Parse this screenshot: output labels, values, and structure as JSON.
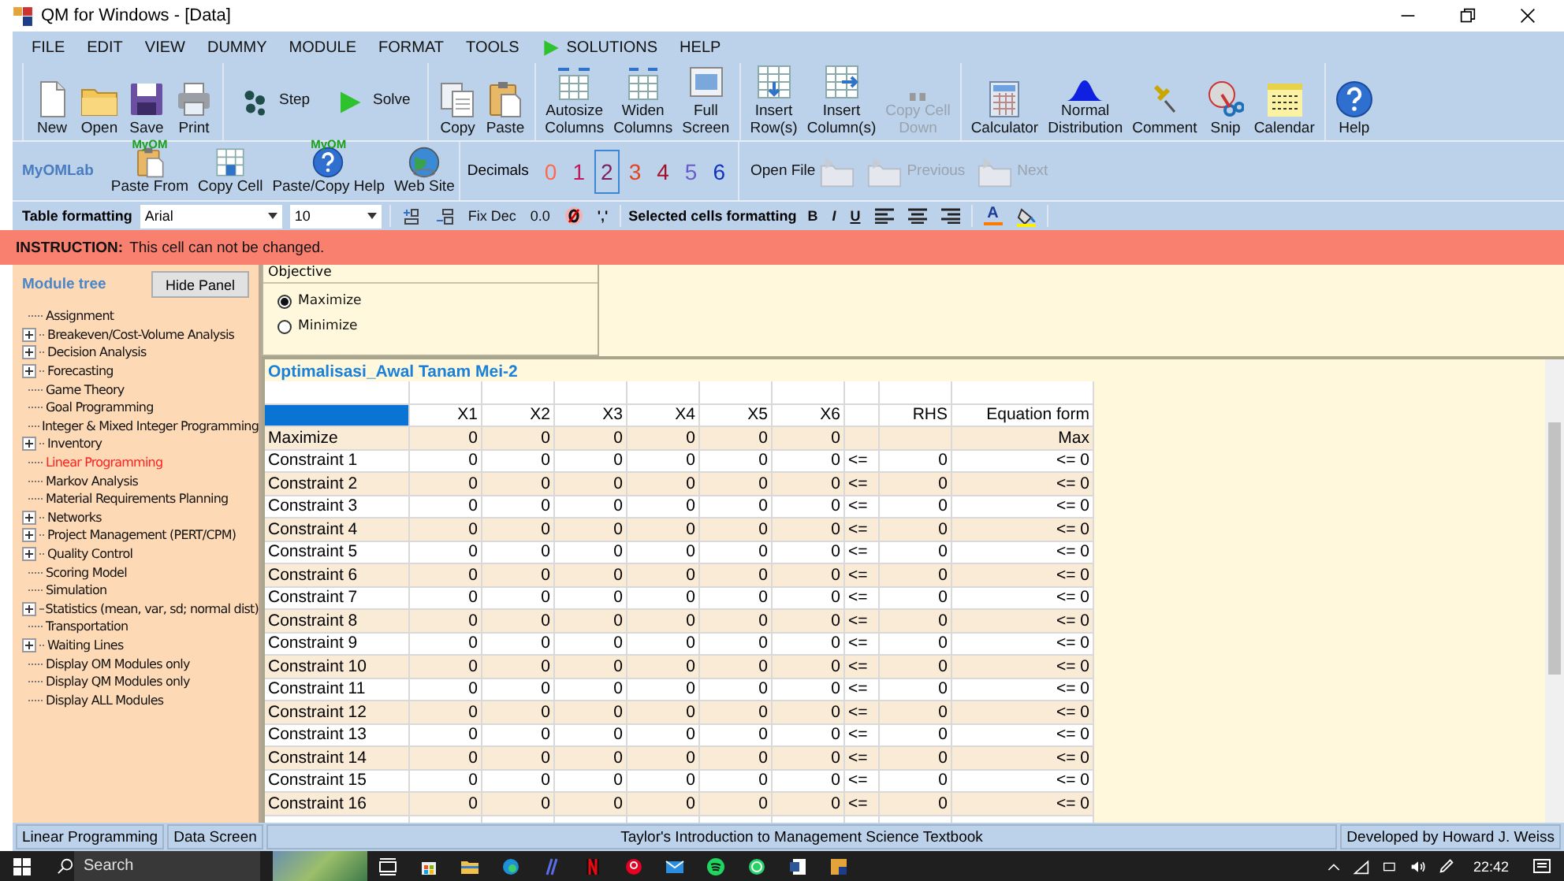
{
  "window": {
    "title": "QM for Windows - [Data]"
  },
  "menu": [
    {
      "label": "FILE",
      "kind": "text"
    },
    {
      "label": "EDIT",
      "kind": "text"
    },
    {
      "label": "VIEW",
      "kind": "text"
    },
    {
      "label": "DUMMY",
      "kind": "text"
    },
    {
      "label": "MODULE",
      "kind": "text"
    },
    {
      "label": "FORMAT",
      "kind": "text"
    },
    {
      "label": "TOOLS",
      "kind": "text"
    },
    {
      "label": "SOLUTIONS",
      "kind": "play"
    },
    {
      "label": "HELP",
      "kind": "text"
    }
  ],
  "toolbar": {
    "groups": [
      [
        {
          "label": "New",
          "kind": "stacked",
          "disabled": false
        },
        {
          "label": "Open",
          "kind": "stacked",
          "disabled": false
        },
        {
          "label": "Save",
          "kind": "stacked",
          "disabled": false
        },
        {
          "label": "Print",
          "kind": "stacked",
          "disabled": false
        }
      ],
      [
        {
          "label": "Step",
          "kind": "inline",
          "disabled": false
        },
        {
          "label": "Solve",
          "kind": "inline",
          "disabled": false
        }
      ],
      [
        {
          "label": "Copy",
          "kind": "stacked",
          "disabled": false
        },
        {
          "label": "Paste",
          "kind": "stacked",
          "disabled": false
        }
      ],
      [
        {
          "label": "Autosize\nColumns",
          "kind": "stacked",
          "disabled": false
        },
        {
          "label": "Widen\nColumns",
          "kind": "stacked",
          "disabled": false
        },
        {
          "label": "Full\nScreen",
          "kind": "stacked",
          "disabled": false
        }
      ],
      [
        {
          "label": "Insert\nRow(s)",
          "kind": "stacked",
          "disabled": false
        },
        {
          "label": "Insert\nColumn(s)",
          "kind": "stacked",
          "disabled": false
        },
        {
          "label": "Copy Cell\nDown",
          "kind": "stacked",
          "disabled": true
        }
      ],
      [
        {
          "label": "Calculator",
          "kind": "stacked",
          "disabled": false
        },
        {
          "label": "Normal\nDistribution",
          "kind": "stacked",
          "disabled": false
        },
        {
          "label": "Comment",
          "kind": "stacked",
          "disabled": false
        },
        {
          "label": "Snip",
          "kind": "stacked",
          "disabled": false
        },
        {
          "label": "Calendar",
          "kind": "stacked",
          "disabled": false
        }
      ],
      [
        {
          "label": "Help",
          "kind": "stacked",
          "disabled": false
        }
      ]
    ]
  },
  "toolbar2": {
    "brand": "MyOMLab",
    "buttons": [
      {
        "label": "Paste From",
        "badge": "MyOM"
      },
      {
        "label": "Copy Cell"
      },
      {
        "label": "Paste/Copy Help",
        "badge": "MyOM"
      },
      {
        "label": "Web Site"
      }
    ],
    "decimals": {
      "label": "Decimals",
      "digits": [
        {
          "label": "0",
          "color": "#ff6a4d",
          "selected": false
        },
        {
          "label": "1",
          "color": "#c2185b",
          "selected": false
        },
        {
          "label": "2",
          "color": "#7b1f5a",
          "selected": true
        },
        {
          "label": "3",
          "color": "#e8401c",
          "selected": false
        },
        {
          "label": "4",
          "color": "#a3102a",
          "selected": false
        },
        {
          "label": "5",
          "color": "#6a5acd",
          "selected": false
        },
        {
          "label": "6",
          "color": "#1030c0",
          "selected": false
        }
      ]
    },
    "files": [
      {
        "label": "Open File",
        "disabled": false
      },
      {
        "label": "Previous",
        "disabled": true
      },
      {
        "label": "Next",
        "disabled": true
      }
    ]
  },
  "format_bar": {
    "label": "Table formatting",
    "font": "Arial",
    "size": "10",
    "fix_dec": "Fix Dec",
    "zero_format": "0.0",
    "comma": "','",
    "selected_label": "Selected cells formatting",
    "styles": [
      "B",
      "I",
      "U"
    ],
    "font_color": "A"
  },
  "instruction": {
    "label": "INSTRUCTION:",
    "text": "This cell can not be changed."
  },
  "module_tree": {
    "title": "Module tree",
    "hide_button": "Hide Panel",
    "items": [
      {
        "label": "Assignment",
        "kind": "leaf",
        "selected": false
      },
      {
        "label": "Breakeven/Cost-Volume Analysis",
        "kind": "branch",
        "selected": false
      },
      {
        "label": "Decision Analysis",
        "kind": "branch",
        "selected": false
      },
      {
        "label": "Forecasting",
        "kind": "branch",
        "selected": false
      },
      {
        "label": "Game Theory",
        "kind": "leaf",
        "selected": false
      },
      {
        "label": "Goal Programming",
        "kind": "leaf",
        "selected": false
      },
      {
        "label": "Integer & Mixed Integer Programming",
        "kind": "leaf",
        "selected": false
      },
      {
        "label": "Inventory",
        "kind": "branch",
        "selected": false
      },
      {
        "label": "Linear Programming",
        "kind": "leaf",
        "selected": true
      },
      {
        "label": "Markov Analysis",
        "kind": "leaf",
        "selected": false
      },
      {
        "label": "Material Requirements Planning",
        "kind": "leaf",
        "selected": false
      },
      {
        "label": "Networks",
        "kind": "branch",
        "selected": false
      },
      {
        "label": "Project Management (PERT/CPM)",
        "kind": "branch",
        "selected": false
      },
      {
        "label": "Quality Control",
        "kind": "branch",
        "selected": false
      },
      {
        "label": "Scoring Model",
        "kind": "leaf",
        "selected": false
      },
      {
        "label": "Simulation",
        "kind": "leaf",
        "selected": false
      },
      {
        "label": "Statistics (mean, var, sd; normal dist)",
        "kind": "branch",
        "selected": false
      },
      {
        "label": "Transportation",
        "kind": "leaf",
        "selected": false
      },
      {
        "label": "Waiting Lines",
        "kind": "branch",
        "selected": false
      },
      {
        "label": "Display OM Modules only",
        "kind": "leaf",
        "selected": false
      },
      {
        "label": "Display QM Modules only",
        "kind": "leaf",
        "selected": false
      },
      {
        "label": "Display ALL Modules",
        "kind": "leaf",
        "selected": false
      }
    ]
  },
  "objective": {
    "legend": "Objective",
    "options": [
      {
        "label": "Maximize",
        "selected": true
      },
      {
        "label": "Minimize",
        "selected": false
      }
    ]
  },
  "table": {
    "title": "Optimalisasi_Awal Tanam Mei-2",
    "corner_selected": true,
    "columns": [
      "X1",
      "X2",
      "X3",
      "X4",
      "X5",
      "X6"
    ],
    "rhs_header": "RHS",
    "equation_header": "Equation form",
    "rows": [
      {
        "name": "Maximize",
        "values": [
          "0",
          "0",
          "0",
          "0",
          "0",
          "0"
        ],
        "equation": "Max"
      },
      {
        "name": "Constraint 1",
        "values": [
          "0",
          "0",
          "0",
          "0",
          "0",
          "0"
        ],
        "sign": "<=",
        "rhs": "0",
        "equation": "<= 0"
      },
      {
        "name": "Constraint 2",
        "values": [
          "0",
          "0",
          "0",
          "0",
          "0",
          "0"
        ],
        "sign": "<=",
        "rhs": "0",
        "equation": "<= 0"
      },
      {
        "name": "Constraint 3",
        "values": [
          "0",
          "0",
          "0",
          "0",
          "0",
          "0"
        ],
        "sign": "<=",
        "rhs": "0",
        "equation": "<= 0"
      },
      {
        "name": "Constraint 4",
        "values": [
          "0",
          "0",
          "0",
          "0",
          "0",
          "0"
        ],
        "sign": "<=",
        "rhs": "0",
        "equation": "<= 0"
      },
      {
        "name": "Constraint 5",
        "values": [
          "0",
          "0",
          "0",
          "0",
          "0",
          "0"
        ],
        "sign": "<=",
        "rhs": "0",
        "equation": "<= 0"
      },
      {
        "name": "Constraint 6",
        "values": [
          "0",
          "0",
          "0",
          "0",
          "0",
          "0"
        ],
        "sign": "<=",
        "rhs": "0",
        "equation": "<= 0"
      },
      {
        "name": "Constraint 7",
        "values": [
          "0",
          "0",
          "0",
          "0",
          "0",
          "0"
        ],
        "sign": "<=",
        "rhs": "0",
        "equation": "<= 0"
      },
      {
        "name": "Constraint 8",
        "values": [
          "0",
          "0",
          "0",
          "0",
          "0",
          "0"
        ],
        "sign": "<=",
        "rhs": "0",
        "equation": "<= 0"
      },
      {
        "name": "Constraint 9",
        "values": [
          "0",
          "0",
          "0",
          "0",
          "0",
          "0"
        ],
        "sign": "<=",
        "rhs": "0",
        "equation": "<= 0"
      },
      {
        "name": "Constraint 10",
        "values": [
          "0",
          "0",
          "0",
          "0",
          "0",
          "0"
        ],
        "sign": "<=",
        "rhs": "0",
        "equation": "<= 0"
      },
      {
        "name": "Constraint 11",
        "values": [
          "0",
          "0",
          "0",
          "0",
          "0",
          "0"
        ],
        "sign": "<=",
        "rhs": "0",
        "equation": "<= 0"
      },
      {
        "name": "Constraint 12",
        "values": [
          "0",
          "0",
          "0",
          "0",
          "0",
          "0"
        ],
        "sign": "<=",
        "rhs": "0",
        "equation": "<= 0"
      },
      {
        "name": "Constraint 13",
        "values": [
          "0",
          "0",
          "0",
          "0",
          "0",
          "0"
        ],
        "sign": "<=",
        "rhs": "0",
        "equation": "<= 0"
      },
      {
        "name": "Constraint 14",
        "values": [
          "0",
          "0",
          "0",
          "0",
          "0",
          "0"
        ],
        "sign": "<=",
        "rhs": "0",
        "equation": "<= 0"
      },
      {
        "name": "Constraint 15",
        "values": [
          "0",
          "0",
          "0",
          "0",
          "0",
          "0"
        ],
        "sign": "<=",
        "rhs": "0",
        "equation": "<= 0"
      },
      {
        "name": "Constraint 16",
        "values": [
          "0",
          "0",
          "0",
          "0",
          "0",
          "0"
        ],
        "sign": "<=",
        "rhs": "0",
        "equation": "<= 0"
      }
    ]
  },
  "status_bar": {
    "module": "Linear Programming",
    "screen": "Data Screen",
    "textbook": "Taylor's Introduction to Management Science Textbook",
    "credit": "Developed by Howard J. Weiss"
  },
  "taskbar": {
    "search": {
      "placeholder": "Search"
    },
    "time": "22:42"
  }
}
